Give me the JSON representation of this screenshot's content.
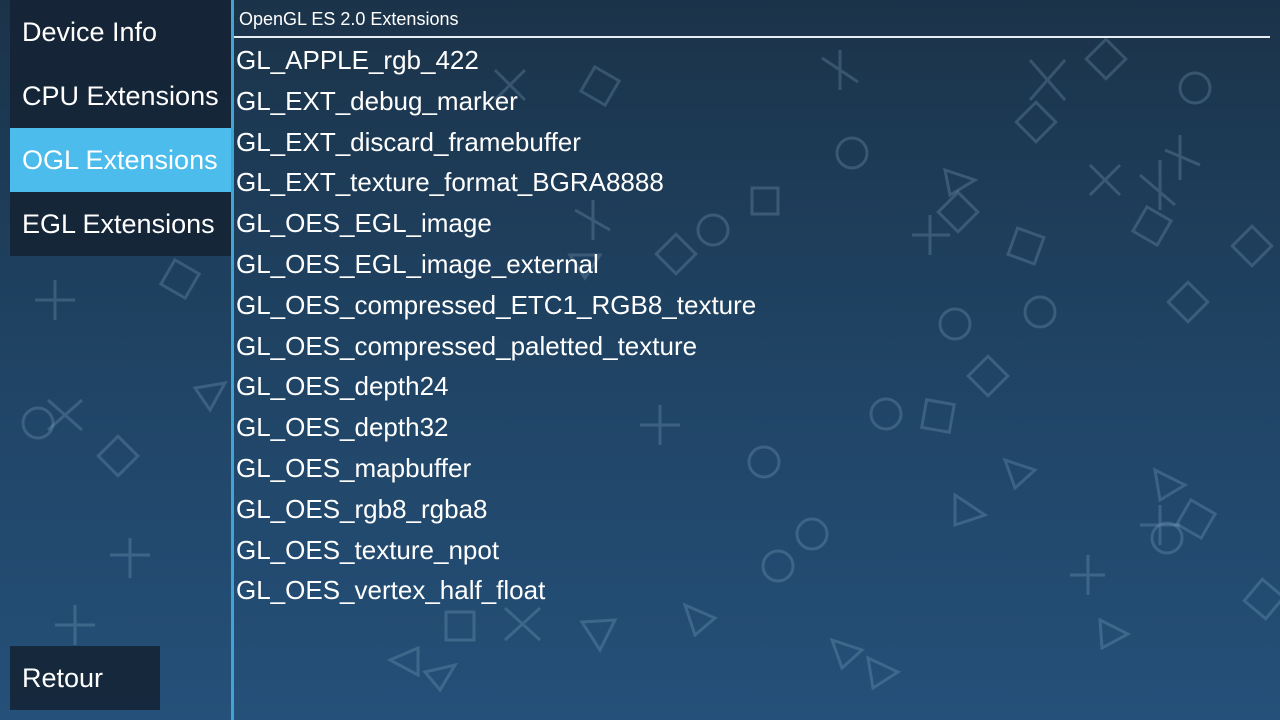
{
  "sidebar": {
    "items": [
      {
        "label": "Device Info",
        "active": false
      },
      {
        "label": "CPU Extensions",
        "active": false
      },
      {
        "label": "OGL Extensions",
        "active": true
      },
      {
        "label": "EGL Extensions",
        "active": false
      }
    ],
    "back_label": "Retour"
  },
  "content": {
    "header": "OpenGL ES 2.0 Extensions",
    "extensions": [
      "GL_APPLE_rgb_422",
      "GL_EXT_debug_marker",
      "GL_EXT_discard_framebuffer",
      "GL_EXT_texture_format_BGRA8888",
      "GL_OES_EGL_image",
      "GL_OES_EGL_image_external",
      "GL_OES_compressed_ETC1_RGB8_texture",
      "GL_OES_compressed_paletted_texture",
      "GL_OES_depth24",
      "GL_OES_depth32",
      "GL_OES_mapbuffer",
      "GL_OES_rgb8_rgba8",
      "GL_OES_texture_npot",
      "GL_OES_vertex_half_float"
    ]
  },
  "colors": {
    "active_item": "#4bbcec",
    "divider": "#3fa5d6",
    "item_bg": "#142334"
  },
  "background_pattern": [
    "circle-icon",
    "cross-icon",
    "square-icon",
    "triangle-icon"
  ]
}
